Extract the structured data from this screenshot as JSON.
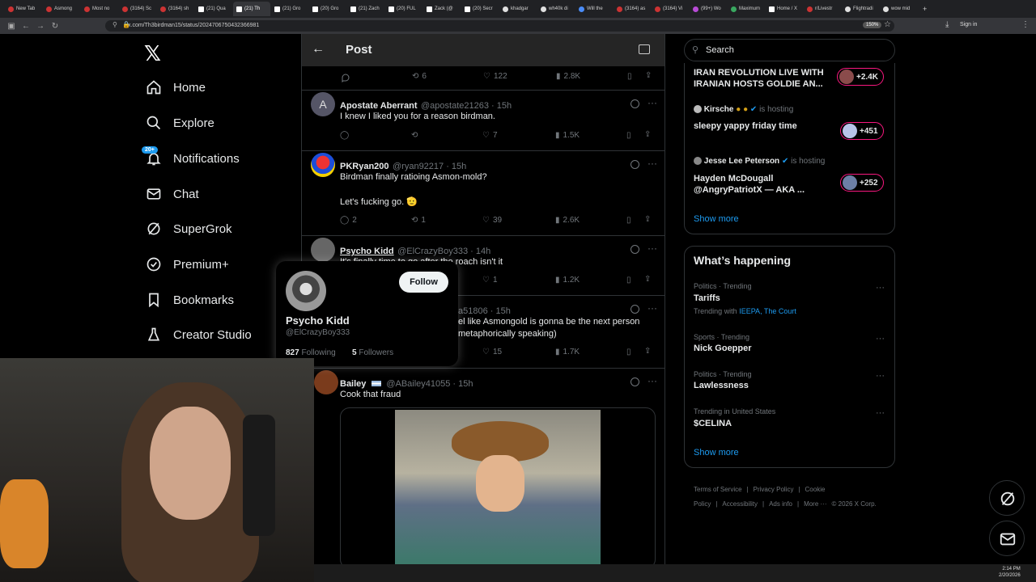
{
  "browser": {
    "tabs": [
      {
        "label": "New Tab",
        "fav": "r"
      },
      {
        "label": "Asmong",
        "fav": "r"
      },
      {
        "label": "Most no",
        "fav": "r"
      },
      {
        "label": "(3164) Sc",
        "fav": "r"
      },
      {
        "label": "(3164) sh",
        "fav": "r"
      },
      {
        "label": "(21) Qua",
        "fav": "x"
      },
      {
        "label": "(21) Th",
        "fav": "x",
        "active": true
      },
      {
        "label": "(21) Gro",
        "fav": "x"
      },
      {
        "label": "(20) Gro",
        "fav": "x"
      },
      {
        "label": "(21) Zach",
        "fav": "x"
      },
      {
        "label": "(20) FUL",
        "fav": "x"
      },
      {
        "label": "Zack (@",
        "fav": "x"
      },
      {
        "label": "(20) Secr",
        "fav": "x"
      },
      {
        "label": "khadgar",
        "fav": "g"
      },
      {
        "label": "wh40k di",
        "fav": "g"
      },
      {
        "label": "Will the",
        "fav": "b"
      },
      {
        "label": "(3164) as",
        "fav": "r"
      },
      {
        "label": "(3164) Vi",
        "fav": "r"
      },
      {
        "label": "(99+) Wo",
        "fav": "p"
      },
      {
        "label": "Maximum",
        "fav": "gr"
      },
      {
        "label": "Home / X",
        "fav": "x"
      },
      {
        "label": "r/Livestr",
        "fav": "r"
      },
      {
        "label": "Flightradi",
        "fav": "g"
      },
      {
        "label": "wow mid",
        "fav": "g"
      }
    ],
    "url": "x.com/Th3birdman15/status/2024706750432366981",
    "zoom": "150%",
    "signin": "Sign in"
  },
  "sidebar": {
    "notif_badge": "20+",
    "items": [
      {
        "label": "Home"
      },
      {
        "label": "Explore"
      },
      {
        "label": "Notifications"
      },
      {
        "label": "Chat"
      },
      {
        "label": "SuperGrok"
      },
      {
        "label": "Premium+"
      },
      {
        "label": "Bookmarks"
      },
      {
        "label": "Creator Studio"
      }
    ]
  },
  "post": {
    "title": "Post",
    "top_actions": {
      "retweets": "6",
      "likes": "122",
      "views": "2.8K"
    },
    "replies": [
      {
        "name": "Apostate Aberrant",
        "handle": "@apostate21263 · 15h",
        "text": "I knew I liked you for a reason birdman.",
        "retweets": "",
        "likes": "7",
        "views": "1.5K",
        "avatar_letter": "A"
      },
      {
        "name": "PKRyan200",
        "handle": "@ryan92217 · 15h",
        "text": "Birdman finally ratioing Asmon-mold?",
        "text2": "Let's fucking go. 🫡",
        "replies": "2",
        "retweets": "1",
        "likes": "39",
        "views": "2.6K"
      },
      {
        "name": "Psycho Kidd",
        "handle": "@ElCrazyBoy333 · 14h",
        "text": "It's finally time to go after the roach isn't it",
        "likes": "1",
        "views": "1.2K"
      },
      {
        "name": "",
        "handle": "a51806 · 15h",
        "text": "el like Asmongold is gonna be the next person",
        "text2": "metaphorically speaking)",
        "likes": "15",
        "views": "1.7K"
      },
      {
        "name": "Bailey",
        "handle": "@ABailey41055 · 15h",
        "text": "Cook that fraud"
      }
    ]
  },
  "popup": {
    "name": "Psycho Kidd",
    "handle": "@ElCrazyBoy333",
    "following_count": "827",
    "following_label": "Following",
    "followers_count": "5",
    "followers_label": "Followers",
    "follow_label": "Follow"
  },
  "right": {
    "search_placeholder": "Search",
    "spaces": [
      {
        "title": "IRAN REVOLUTION LIVE WITH IRANIAN HOSTS GOLDIE AN...",
        "count": "+2.4K"
      },
      {
        "host": "Kirsche",
        "hosting": "is hosting",
        "title": "sleepy yappy friday time",
        "count": "+451"
      },
      {
        "host": "Jesse Lee Peterson",
        "hosting": "is hosting",
        "title": "Hayden McDougall @AngryPatriotX — AKA ...",
        "count": "+252"
      }
    ],
    "show_more": "Show more",
    "happening_title": "What’s happening",
    "trends": [
      {
        "category": "Politics · Trending",
        "name": "Tariffs",
        "extra_prefix": "Trending with",
        "extra_links": "IEEPA, The Court"
      },
      {
        "category": "Sports · Trending",
        "name": "Nick Goepper"
      },
      {
        "category": "Politics · Trending",
        "name": "Lawlessness"
      },
      {
        "category": "Trending in United States",
        "name": "$CELINA"
      }
    ],
    "show_more2": "Show more",
    "footer": [
      "Terms of Service",
      "|",
      "Privacy Policy",
      "|",
      "Cookie Policy",
      "|",
      "Accessibility",
      "|",
      "Ads info",
      "|",
      "More ···",
      "© 2026 X Corp."
    ]
  },
  "clock": {
    "time": "2:14 PM",
    "date": "2/20/2026"
  }
}
